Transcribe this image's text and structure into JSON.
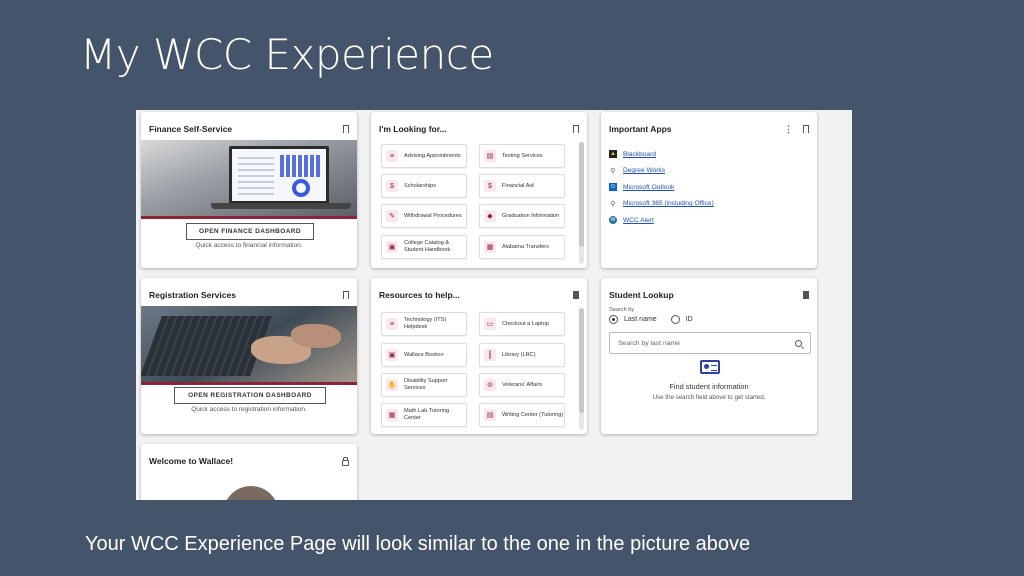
{
  "slide": {
    "title": "My WCC Experience",
    "caption": "Your WCC Experience Page will look similar to the one in the picture above"
  },
  "finance": {
    "title": "Finance Self-Service",
    "button": "OPEN FINANCE DASHBOARD",
    "subtitle": "Quick access to financial information."
  },
  "looking": {
    "title": "I'm Looking for...",
    "items": [
      {
        "label": "Advising Appointments",
        "icon": "list-icon"
      },
      {
        "label": "Testing Services",
        "icon": "document-icon"
      },
      {
        "label": "Scholarships",
        "icon": "dollar-icon"
      },
      {
        "label": "Financial Aid",
        "icon": "dollar-icon"
      },
      {
        "label": "Withdrawal Procedures",
        "icon": "edit-icon"
      },
      {
        "label": "Graduation Information",
        "icon": "graduation-cap-icon"
      },
      {
        "label": "College Catalog & Student Handbook",
        "icon": "book-icon"
      },
      {
        "label": "Alabama Transfers",
        "icon": "clipboard-icon"
      }
    ]
  },
  "apps": {
    "title": "Important Apps",
    "items": [
      {
        "label": "Blackboard",
        "icon": "blackboard-icon"
      },
      {
        "label": "Degree Works",
        "icon": "link-icon"
      },
      {
        "label": "Microsoft Outlook",
        "icon": "outlook-icon"
      },
      {
        "label": "Microsoft 365 (including Office)",
        "icon": "link-icon"
      },
      {
        "label": "WCC Alert",
        "icon": "wordpress-icon"
      }
    ]
  },
  "registration": {
    "title": "Registration Services",
    "button": "OPEN REGISTRATION DASHBOARD",
    "subtitle": "Quick access to registration information."
  },
  "resources": {
    "title": "Resources to help...",
    "items": [
      {
        "label": "Technology (ITS) Helpdesk",
        "icon": "list-icon"
      },
      {
        "label": "Checkout a Laptop",
        "icon": "laptop-icon"
      },
      {
        "label": "Wallace Books+",
        "icon": "book-icon"
      },
      {
        "label": "Library (LRC)",
        "icon": "library-icon"
      },
      {
        "label": "Disability Support Services",
        "icon": "support-icon"
      },
      {
        "label": "Veterans' Affairs",
        "icon": "ban-icon"
      },
      {
        "label": "Math Lab Tutoring Center",
        "icon": "calculator-icon"
      },
      {
        "label": "Writing Center (Tutoring)",
        "icon": "document-icon"
      }
    ]
  },
  "lookup": {
    "title": "Student Lookup",
    "search_by": "Search by",
    "option_last": "Last name",
    "option_id": "ID",
    "placeholder": "Search by last name",
    "find_title": "Find student information",
    "find_sub": "Use the search field above to get started."
  },
  "welcome": {
    "title": "Welcome to Wallace!"
  },
  "colors": {
    "slide_bg": "#44546a",
    "accent": "#8a2436",
    "link": "#1f4fbf"
  }
}
